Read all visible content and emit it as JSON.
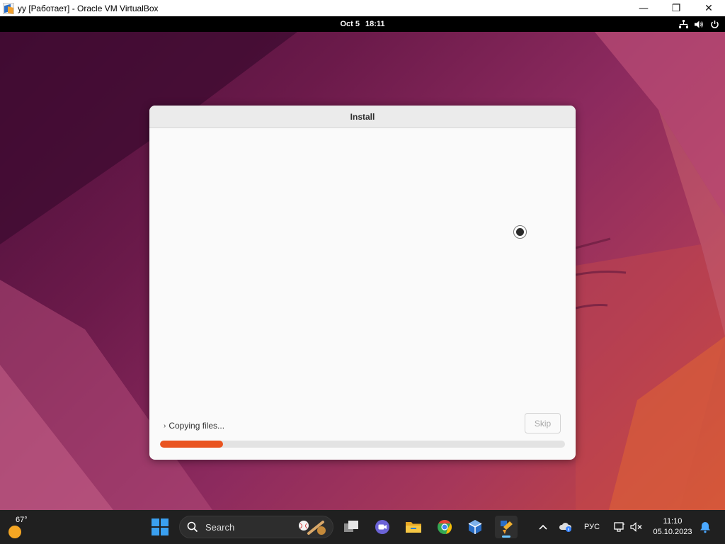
{
  "host_window": {
    "title": "yy [Работает] - Oracle VM VirtualBox",
    "controls": {
      "minimize": "—",
      "restore": "❐",
      "close": "✕"
    }
  },
  "guest_topbar": {
    "date": "Oct 5",
    "time": "18:11",
    "tray_icons": [
      "network-icon",
      "volume-icon",
      "power-icon"
    ]
  },
  "installer": {
    "title": "Install",
    "status_text": "Copying files...",
    "skip_label": "Skip",
    "progress_fraction": 0.155,
    "accent_color": "#e95420"
  },
  "taskbar": {
    "weather_temp": "67°",
    "search_label": "Search",
    "language": "РУС",
    "clock_time": "11:10",
    "clock_date": "05.10.2023",
    "apps": [
      "start-menu",
      "task-view",
      "teams-chat",
      "file-explorer",
      "chrome",
      "virtualbox-manager",
      "virtualbox-vm"
    ]
  }
}
